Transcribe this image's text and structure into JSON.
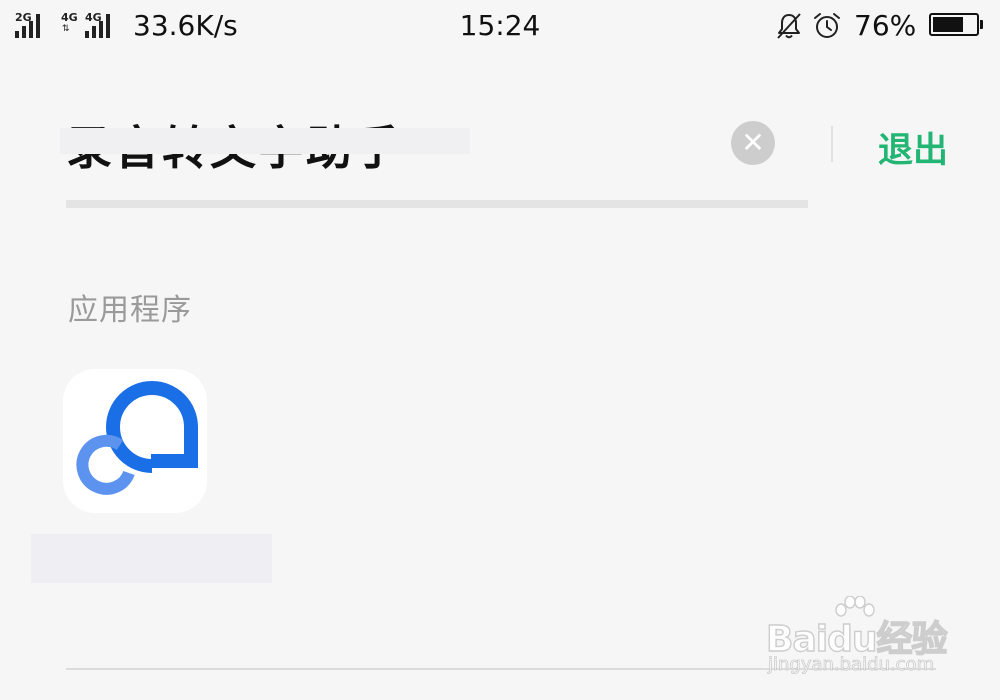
{
  "status_bar": {
    "signal_1_network": "2G",
    "signal_2_network": "4G",
    "signal_2b_network": "4G",
    "net_speed": "33.6K/s",
    "time": "15:24",
    "icons": [
      "bell-off-icon",
      "alarm-clock-icon"
    ],
    "battery_percent": "76%",
    "battery_level": 0.76
  },
  "search": {
    "query": "录音转文字助手",
    "clear_icon": "close-icon",
    "exit_label": "退出"
  },
  "results": {
    "section_title": "应用程序",
    "apps": [
      {
        "icon": "app-chat-bubble-icon",
        "name": ""
      }
    ]
  },
  "watermark": {
    "brand": "Baidu经验",
    "site": "jingyan.baidu.com"
  },
  "colors": {
    "background": "#f6f6f6",
    "accent_green": "#22b573",
    "app_blue_dark": "#1a6fe6",
    "app_blue_light": "#5b93ef",
    "section_grey": "#9a9a9a"
  }
}
